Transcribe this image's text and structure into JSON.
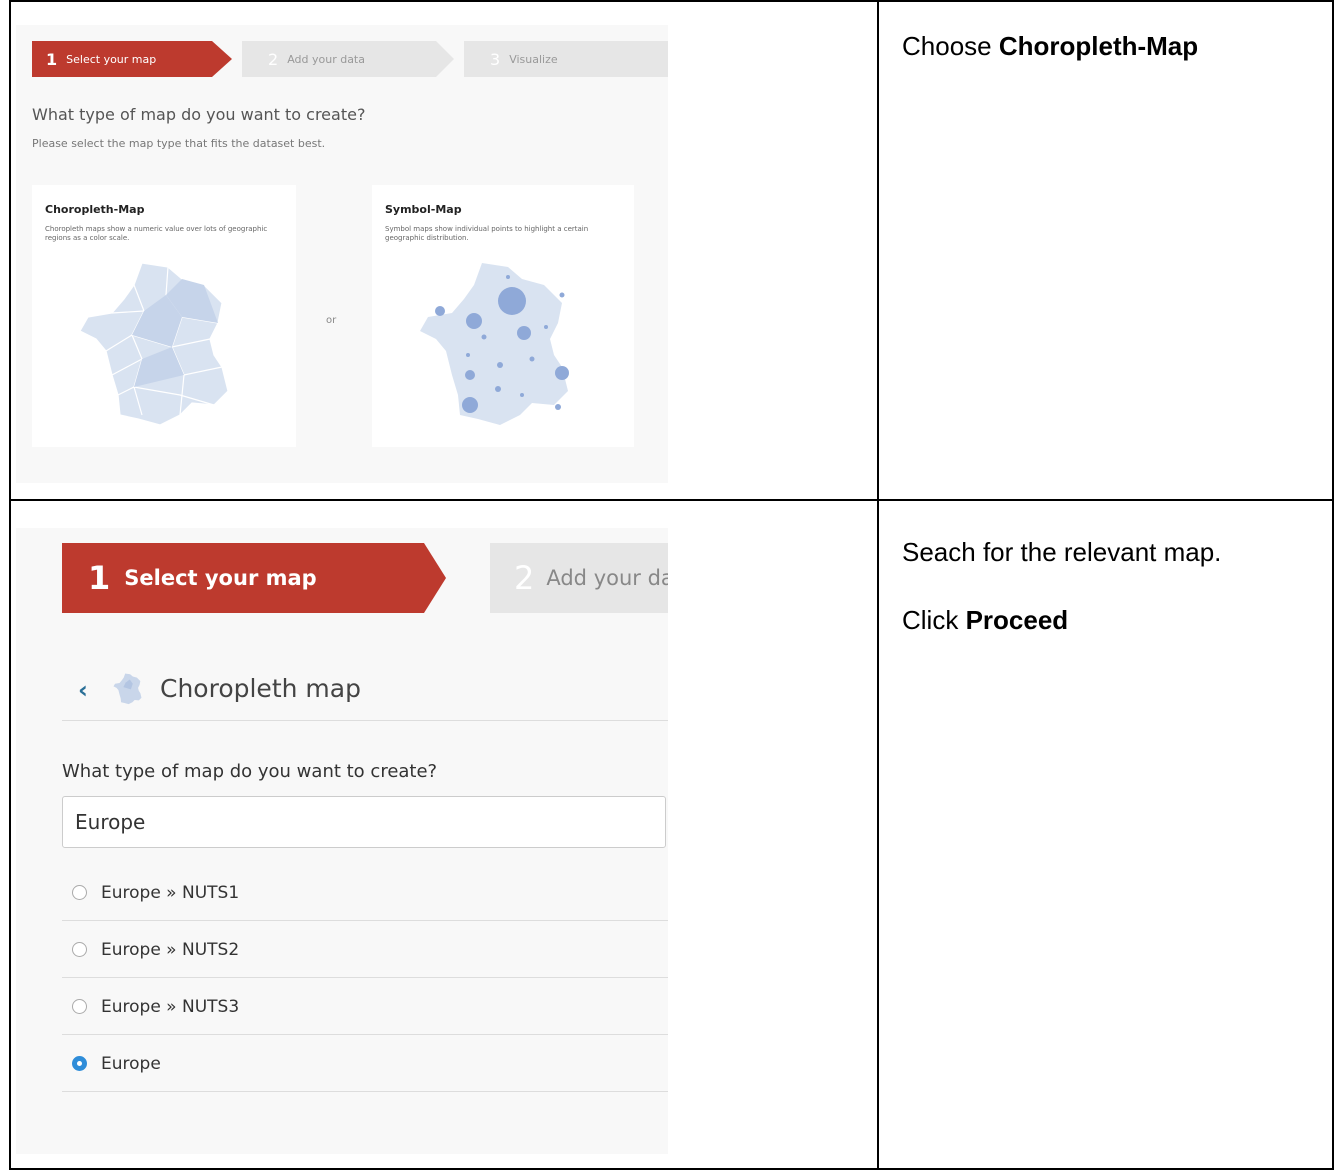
{
  "step1": {
    "wizard": {
      "steps": [
        {
          "num": "1",
          "label": "Select your map"
        },
        {
          "num": "2",
          "label": "Add your data"
        },
        {
          "num": "3",
          "label": "Visualize"
        }
      ]
    },
    "question": "What type of map do you want to create?",
    "subtitle": "Please select the map type that fits the dataset best.",
    "cards": [
      {
        "title": "Choropleth-Map",
        "desc": "Choropleth maps show a numeric value over lots of geographic regions as a color scale."
      },
      {
        "title": "Symbol-Map",
        "desc": "Symbol maps show individual points to highlight a certain geographic distribution."
      }
    ],
    "or_label": "or",
    "colors": {
      "active": "#bd3a2e",
      "inactive": "#e6e6e6",
      "map_fill": "#d9e3f1",
      "symbol": "#8fa9d8"
    },
    "instruction": {
      "prefix": "Choose ",
      "bold": "Choropleth-Map"
    }
  },
  "step2": {
    "wizard": {
      "steps": [
        {
          "num": "1",
          "label": "Select your map"
        },
        {
          "num": "2",
          "label": "Add your dat"
        }
      ]
    },
    "back": {
      "title": "Choropleth map"
    },
    "question": "What type of map do you want to create?",
    "search": {
      "value": "Europe"
    },
    "options": [
      {
        "label": "Europe » NUTS1",
        "selected": false
      },
      {
        "label": "Europe » NUTS2",
        "selected": false
      },
      {
        "label": "Europe » NUTS3",
        "selected": false
      },
      {
        "label": "Europe",
        "selected": true
      }
    ],
    "instruction": {
      "line1": "Seach for the relevant map.",
      "prefix": "Click ",
      "bold": "Proceed"
    }
  }
}
